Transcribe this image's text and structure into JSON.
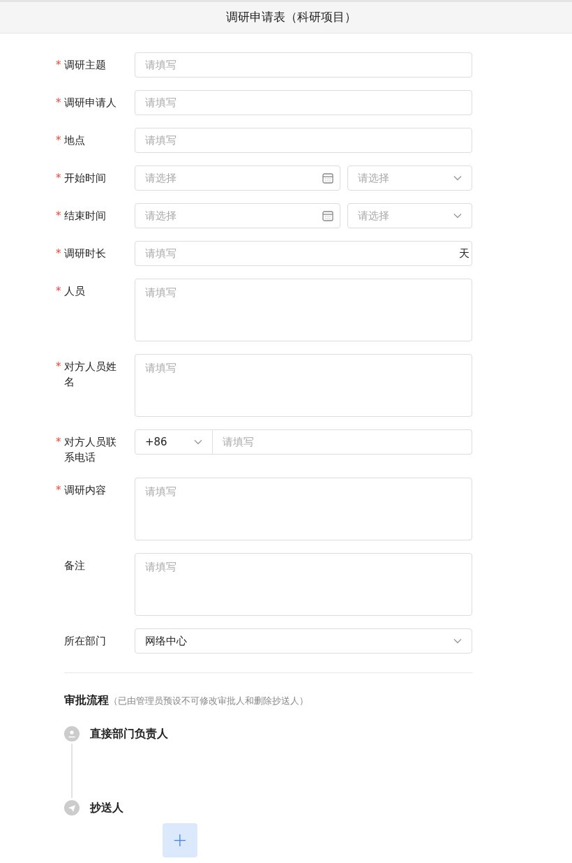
{
  "header": {
    "title": "调研申请表（科研项目）"
  },
  "fields": [
    {
      "kind": "text",
      "required_mark": "*",
      "label": "调研主题",
      "placeholder": "请填写"
    },
    {
      "kind": "text",
      "required_mark": "*",
      "label": "调研申请人",
      "placeholder": "请填写"
    },
    {
      "kind": "text",
      "required_mark": "*",
      "label": "地点",
      "placeholder": "请填写"
    },
    {
      "kind": "datetime",
      "required_mark": "*",
      "label": "开始时间",
      "placeholder": "请选择",
      "time_placeholder": "请选择"
    },
    {
      "kind": "datetime",
      "required_mark": "*",
      "label": "结束时间",
      "placeholder": "请选择",
      "time_placeholder": "请选择"
    },
    {
      "kind": "suffix",
      "required_mark": "*",
      "label": "调研时长",
      "placeholder": "请填写",
      "suffix": "天"
    },
    {
      "kind": "textarea",
      "required_mark": "*",
      "label": "人员",
      "placeholder": "请填写"
    },
    {
      "kind": "textarea",
      "required_mark": "*",
      "label": "对方人员姓名",
      "placeholder": "请填写"
    },
    {
      "kind": "phone",
      "required_mark": "*",
      "label": "对方人员联系电话",
      "code": "+86",
      "placeholder": "请填写"
    },
    {
      "kind": "textarea",
      "required_mark": "*",
      "label": "调研内容",
      "placeholder": "请填写"
    },
    {
      "kind": "textarea",
      "label": "备注",
      "placeholder": "请填写"
    },
    {
      "kind": "select",
      "label": "所在部门",
      "value": "网络中心"
    }
  ],
  "approval": {
    "title": "审批流程",
    "note": "（已由管理员预设不可修改审批人和删除抄送人）",
    "steps": [
      {
        "kind": "approver",
        "label": "直接部门负责人"
      },
      {
        "kind": "cc",
        "label": "抄送人"
      }
    ],
    "add_button": "+"
  }
}
